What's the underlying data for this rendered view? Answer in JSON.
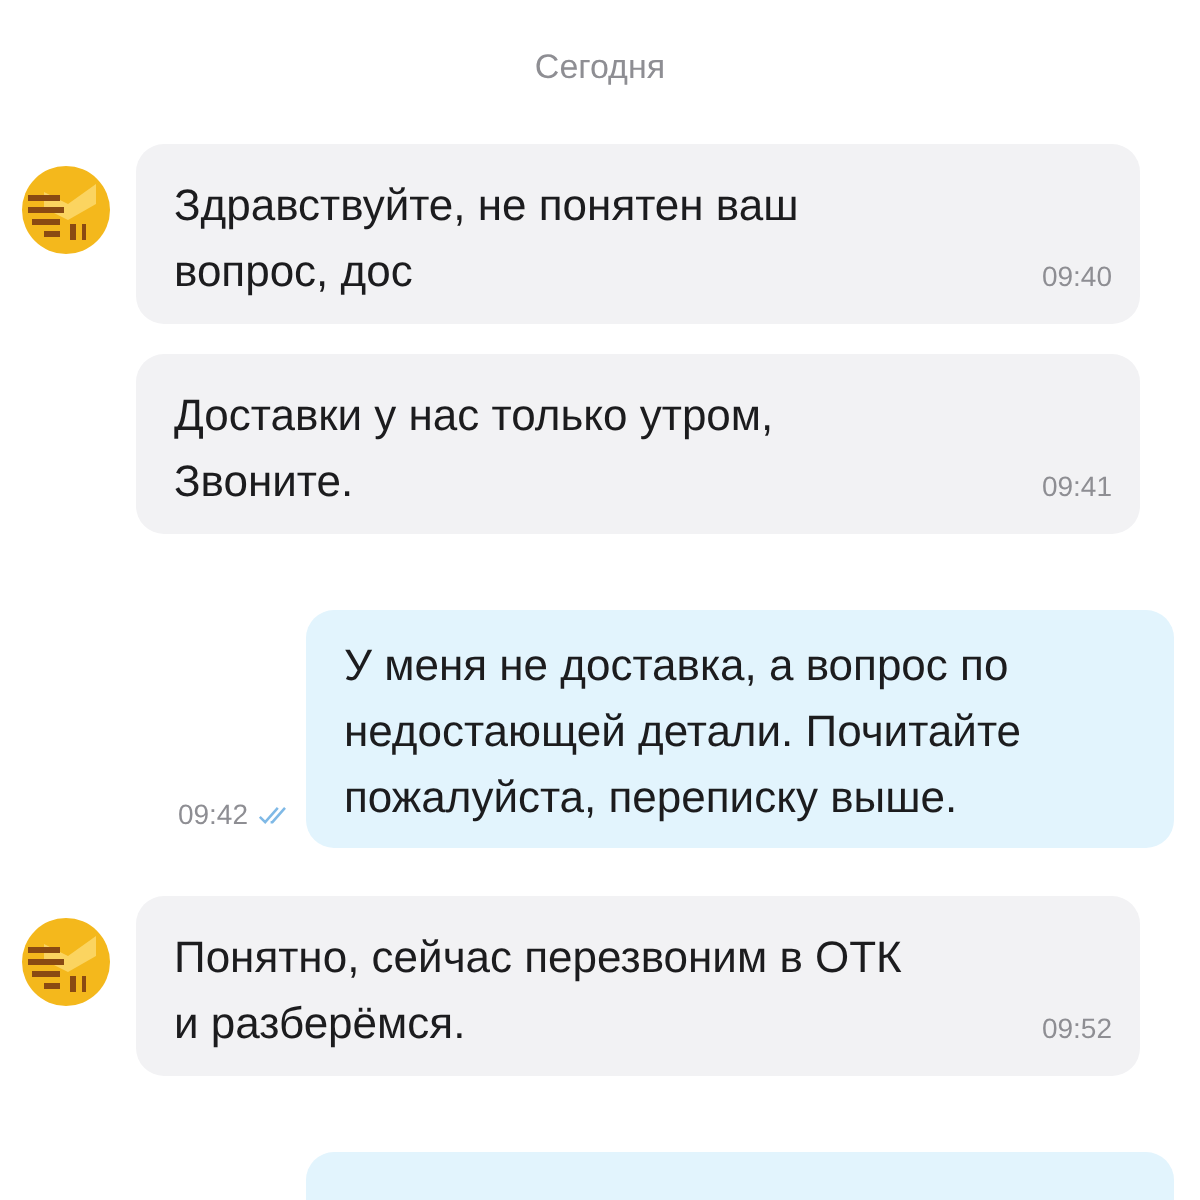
{
  "date_separator": "Сегодня",
  "messages": [
    {
      "kind": "incoming",
      "avatar": true,
      "text": "Здравствуйте, не понятен ваш вопрос, дос",
      "time": "09:40"
    },
    {
      "kind": "incoming",
      "avatar": false,
      "text": "Доставки у нас только утром, Звоните.",
      "time": "09:41"
    },
    {
      "kind": "outgoing",
      "text": "У меня не доставка, а вопрос по недостающей детали. Почитайте пожалуйста, переписку выше.",
      "time": "09:42",
      "read": true
    },
    {
      "kind": "incoming",
      "avatar": true,
      "text": "Понятно, сейчас перезвоним в ОТК и разберёмся.",
      "time": "09:52"
    },
    {
      "kind": "outgoing",
      "partial": true
    }
  ]
}
